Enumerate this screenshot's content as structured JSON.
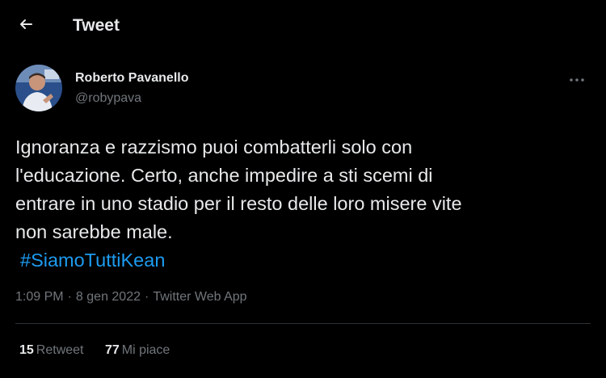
{
  "header": {
    "title": "Tweet",
    "back_icon": "arrow-left-icon"
  },
  "author": {
    "name": "Roberto Pavanello",
    "handle": "@robypava"
  },
  "tweet": {
    "lines": [
      "Ignoranza e razzismo puoi combatterli solo con",
      "l'educazione. Certo, anche impedire a sti scemi di",
      "entrare in uno stadio per il resto delle loro misere vite",
      "non sarebbe male."
    ],
    "hashtag": "#SiamoTuttiKean"
  },
  "meta": {
    "time": "1:09 PM",
    "date": "8 gen 2022",
    "app": "Twitter Web App",
    "separator": "·"
  },
  "stats": {
    "retweets": {
      "count": "15",
      "label": "Retweet"
    },
    "likes": {
      "count": "77",
      "label": "Mi piace"
    }
  },
  "colors": {
    "background": "#000000",
    "text": "#e7e9ea",
    "muted": "#71767b",
    "link": "#1d9bf0",
    "divider": "#2f3336"
  }
}
